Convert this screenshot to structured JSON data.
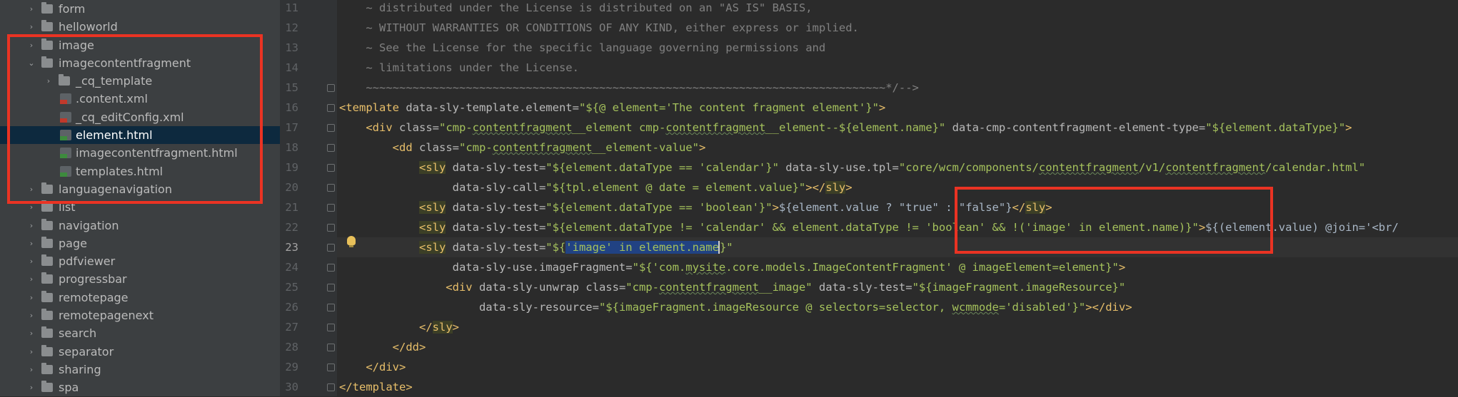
{
  "tree": {
    "items": [
      {
        "label": "form",
        "type": "folder",
        "depth": 1,
        "chevron": "›"
      },
      {
        "label": "helloworld",
        "type": "folder",
        "depth": 1,
        "chevron": "›"
      },
      {
        "label": "image",
        "type": "folder",
        "depth": 1,
        "chevron": "›"
      },
      {
        "label": "imagecontentfragment",
        "type": "folder",
        "depth": 1,
        "chevron": "⌄"
      },
      {
        "label": "_cq_template",
        "type": "folder",
        "depth": 2,
        "chevron": "›"
      },
      {
        "label": ".content.xml",
        "type": "xml",
        "depth": 2,
        "chevron": ""
      },
      {
        "label": "_cq_editConfig.xml",
        "type": "xml",
        "depth": 2,
        "chevron": ""
      },
      {
        "label": "element.html",
        "type": "html",
        "depth": 2,
        "chevron": "",
        "selected": true
      },
      {
        "label": "imagecontentfragment.html",
        "type": "html",
        "depth": 2,
        "chevron": ""
      },
      {
        "label": "templates.html",
        "type": "html",
        "depth": 2,
        "chevron": ""
      },
      {
        "label": "languagenavigation",
        "type": "folder",
        "depth": 1,
        "chevron": "›"
      },
      {
        "label": "list",
        "type": "folder",
        "depth": 1,
        "chevron": "›"
      },
      {
        "label": "navigation",
        "type": "folder",
        "depth": 1,
        "chevron": "›"
      },
      {
        "label": "page",
        "type": "folder",
        "depth": 1,
        "chevron": "›"
      },
      {
        "label": "pdfviewer",
        "type": "folder",
        "depth": 1,
        "chevron": "›"
      },
      {
        "label": "progressbar",
        "type": "folder",
        "depth": 1,
        "chevron": "›"
      },
      {
        "label": "remotepage",
        "type": "folder",
        "depth": 1,
        "chevron": "›"
      },
      {
        "label": "remotepagenext",
        "type": "folder",
        "depth": 1,
        "chevron": "›"
      },
      {
        "label": "search",
        "type": "folder",
        "depth": 1,
        "chevron": "›"
      },
      {
        "label": "separator",
        "type": "folder",
        "depth": 1,
        "chevron": "›"
      },
      {
        "label": "sharing",
        "type": "folder",
        "depth": 1,
        "chevron": "›"
      },
      {
        "label": "spa",
        "type": "folder",
        "depth": 1,
        "chevron": "›"
      }
    ]
  },
  "editor": {
    "current_line": 23,
    "lines": [
      {
        "n": "11",
        "fold": false,
        "segs": [
          [
            "cm",
            "    ~ distributed under the License is distributed on an \"AS IS\" BASIS,"
          ]
        ]
      },
      {
        "n": "12",
        "fold": false,
        "segs": [
          [
            "cm",
            "    ~ WITHOUT WARRANTIES OR CONDITIONS OF ANY KIND, either express or implied."
          ]
        ]
      },
      {
        "n": "13",
        "fold": false,
        "segs": [
          [
            "cm",
            "    ~ See the License for the specific language governing permissions and"
          ]
        ]
      },
      {
        "n": "14",
        "fold": false,
        "segs": [
          [
            "cm",
            "    ~ limitations under the License."
          ]
        ]
      },
      {
        "n": "15",
        "fold": true,
        "segs": [
          [
            "cm",
            "    ~~~~~~~~~~~~~~~~~~~~~~~~~~~~~~~~~~~~~~~~~~~~~~~~~~~~~~~~~~~~~~~~~~~~~~~~~~~~~~*/-->"
          ]
        ]
      },
      {
        "n": "16",
        "fold": true,
        "segs": [
          [
            "tg",
            "<template"
          ],
          [
            "at",
            " data-sly-template.element="
          ],
          [
            "sv",
            "\"${@ element='The content fragment element'}\""
          ],
          [
            "tg",
            ">"
          ]
        ]
      },
      {
        "n": "17",
        "fold": true,
        "segs": [
          [
            "tg",
            "    <div"
          ],
          [
            "at",
            " class="
          ],
          [
            "sv",
            "\"cmp-"
          ],
          [
            "svu",
            "contentfragment"
          ],
          [
            "sv",
            "__element cmp-"
          ],
          [
            "svu",
            "contentfragment"
          ],
          [
            "sv",
            "__element--${element.name}\""
          ],
          [
            "at",
            " data-cmp-contentfragment-element-type="
          ],
          [
            "sv",
            "\"${element.dataType}\""
          ],
          [
            "tg",
            ">"
          ]
        ]
      },
      {
        "n": "18",
        "fold": true,
        "segs": [
          [
            "tg",
            "        <dd"
          ],
          [
            "at",
            " class="
          ],
          [
            "sv",
            "\"cmp-"
          ],
          [
            "svu",
            "contentfragment"
          ],
          [
            "sv",
            "__element-value\""
          ],
          [
            "tg",
            ">"
          ]
        ]
      },
      {
        "n": "19",
        "fold": true,
        "segs": [
          [
            "pl",
            "            "
          ],
          [
            "tgb",
            "<sly"
          ],
          [
            "at",
            " data-sly-test="
          ],
          [
            "sv",
            "\"${element.dataType == 'calendar'}\""
          ],
          [
            "at",
            " data-sly-use.tpl="
          ],
          [
            "sv",
            "\"core/wcm/components/"
          ],
          [
            "svu",
            "contentfragment"
          ],
          [
            "sv",
            "/v1/"
          ],
          [
            "svu",
            "contentfragment"
          ],
          [
            "sv",
            "/calendar.html\""
          ]
        ]
      },
      {
        "n": "20",
        "fold": true,
        "segs": [
          [
            "at",
            "                 data-sly-call="
          ],
          [
            "sv",
            "\"${tpl.element @ date = element.value}\""
          ],
          [
            "tg",
            "></"
          ],
          [
            "tgb",
            "sly"
          ],
          [
            "tg",
            ">"
          ]
        ]
      },
      {
        "n": "21",
        "fold": true,
        "segs": [
          [
            "pl",
            "            "
          ],
          [
            "tgb",
            "<sly"
          ],
          [
            "at",
            " data-sly-test="
          ],
          [
            "sv",
            "\"${element.dataType == 'boolean'}\""
          ],
          [
            "tg",
            ">"
          ],
          [
            "pl",
            "${element.value ? \"true\" : \"false\"}"
          ],
          [
            "tg",
            "</"
          ],
          [
            "tgb",
            "sly"
          ],
          [
            "tg",
            ">"
          ]
        ]
      },
      {
        "n": "22",
        "fold": true,
        "segs": [
          [
            "pl",
            "            "
          ],
          [
            "tgb",
            "<sly"
          ],
          [
            "at",
            " data-sly-test="
          ],
          [
            "sv",
            "\"${element.dataType != 'calendar' && element.dataType != 'boolean' && !('image' in element.name)}\""
          ],
          [
            "tg",
            ">"
          ],
          [
            "pl",
            "${(element.value) @join='<br/"
          ]
        ]
      },
      {
        "n": "23",
        "fold": true,
        "segs": [
          [
            "pl",
            "            "
          ],
          [
            "tgb",
            "<sly"
          ],
          [
            "at",
            " data-sly-test="
          ],
          [
            "sv",
            "\"${"
          ],
          [
            "svsel",
            "'image' in element.name"
          ],
          [
            "caret",
            ""
          ],
          [
            "sv",
            "}\""
          ]
        ]
      },
      {
        "n": "24",
        "fold": true,
        "segs": [
          [
            "at",
            "                 data-sly-use.imageFragment="
          ],
          [
            "sv",
            "\"${'com."
          ],
          [
            "svu",
            "mysite"
          ],
          [
            "sv",
            ".core.models.ImageContentFragment' @ imageElement=element}\""
          ],
          [
            "tg",
            ">"
          ]
        ]
      },
      {
        "n": "25",
        "fold": true,
        "segs": [
          [
            "tg",
            "                <div"
          ],
          [
            "at",
            " data-sly-unwrap class="
          ],
          [
            "sv",
            "\"cmp-"
          ],
          [
            "svu",
            "contentfragment"
          ],
          [
            "sv",
            "__image\""
          ],
          [
            "at",
            " data-sly-test="
          ],
          [
            "sv",
            "\"${imageFragment.imageResource}\""
          ]
        ]
      },
      {
        "n": "26",
        "fold": true,
        "segs": [
          [
            "at",
            "                     data-sly-resource="
          ],
          [
            "sv",
            "\"${imageFragment.imageResource @ selectors=selector, "
          ],
          [
            "svu",
            "wcmmode"
          ],
          [
            "sv",
            "='disabled'}\""
          ],
          [
            "tg",
            "></div>"
          ]
        ]
      },
      {
        "n": "27",
        "fold": true,
        "segs": [
          [
            "pl",
            "            "
          ],
          [
            "tg",
            "</"
          ],
          [
            "tgb",
            "sly"
          ],
          [
            "tg",
            ">"
          ]
        ]
      },
      {
        "n": "28",
        "fold": true,
        "segs": [
          [
            "tg",
            "        </dd>"
          ]
        ]
      },
      {
        "n": "29",
        "fold": true,
        "segs": [
          [
            "tg",
            "    </div>"
          ]
        ]
      },
      {
        "n": "30",
        "fold": true,
        "segs": [
          [
            "tg",
            "</template>"
          ]
        ]
      }
    ]
  },
  "colors": {
    "annotation_red": "#ea3323",
    "selection_bg": "#0d293e",
    "text_selection": "#214283"
  }
}
